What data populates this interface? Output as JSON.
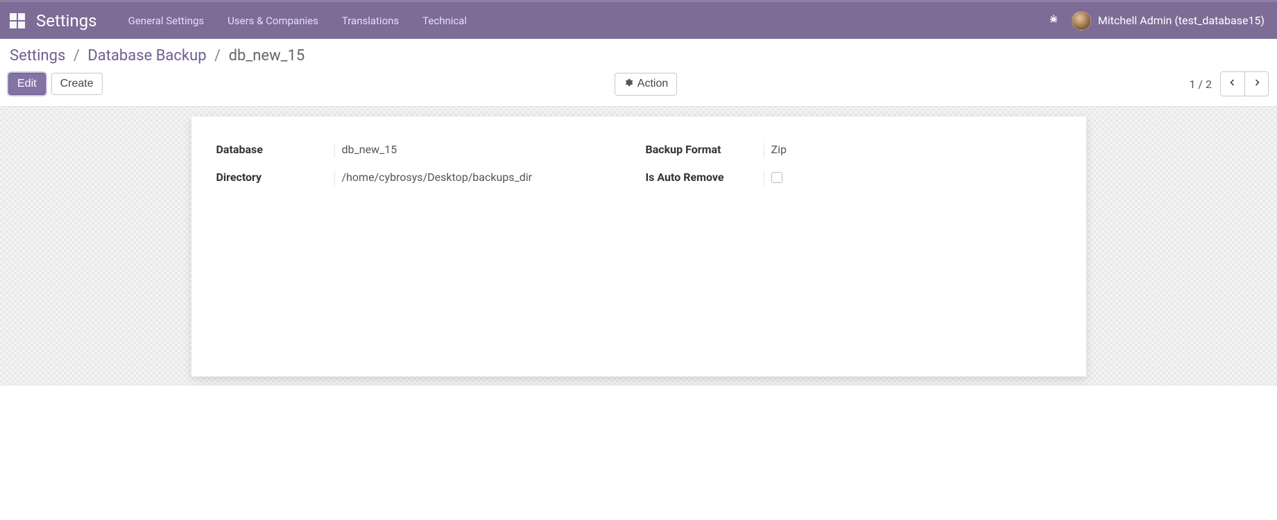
{
  "nav": {
    "app_title": "Settings",
    "items": [
      "General Settings",
      "Users & Companies",
      "Translations",
      "Technical"
    ],
    "user_name": "Mitchell Admin (test_database15)"
  },
  "breadcrumb": {
    "root": "Settings",
    "module": "Database Backup",
    "current": "db_new_15"
  },
  "buttons": {
    "edit": "Edit",
    "create": "Create",
    "action": "Action"
  },
  "pager": {
    "current": "1",
    "total": "2"
  },
  "form": {
    "left": {
      "database_label": "Database",
      "database_value": "db_new_15",
      "directory_label": "Directory",
      "directory_value": "/home/cybrosys/Desktop/backups_dir"
    },
    "right": {
      "format_label": "Backup Format",
      "format_value": "Zip",
      "auto_remove_label": "Is Auto Remove",
      "auto_remove_checked": false
    }
  }
}
